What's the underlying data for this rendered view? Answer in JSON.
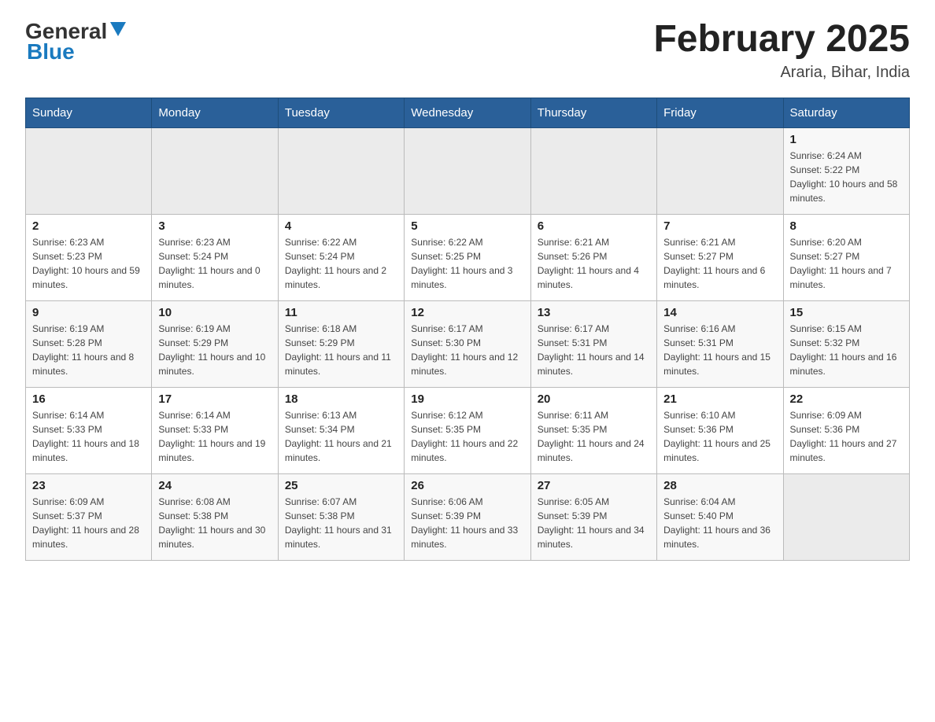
{
  "header": {
    "logo_general": "General",
    "logo_blue": "Blue",
    "title": "February 2025",
    "subtitle": "Araria, Bihar, India"
  },
  "weekdays": [
    "Sunday",
    "Monday",
    "Tuesday",
    "Wednesday",
    "Thursday",
    "Friday",
    "Saturday"
  ],
  "weeks": [
    [
      {
        "day": "",
        "sunrise": "",
        "sunset": "",
        "daylight": ""
      },
      {
        "day": "",
        "sunrise": "",
        "sunset": "",
        "daylight": ""
      },
      {
        "day": "",
        "sunrise": "",
        "sunset": "",
        "daylight": ""
      },
      {
        "day": "",
        "sunrise": "",
        "sunset": "",
        "daylight": ""
      },
      {
        "day": "",
        "sunrise": "",
        "sunset": "",
        "daylight": ""
      },
      {
        "day": "",
        "sunrise": "",
        "sunset": "",
        "daylight": ""
      },
      {
        "day": "1",
        "sunrise": "Sunrise: 6:24 AM",
        "sunset": "Sunset: 5:22 PM",
        "daylight": "Daylight: 10 hours and 58 minutes."
      }
    ],
    [
      {
        "day": "2",
        "sunrise": "Sunrise: 6:23 AM",
        "sunset": "Sunset: 5:23 PM",
        "daylight": "Daylight: 10 hours and 59 minutes."
      },
      {
        "day": "3",
        "sunrise": "Sunrise: 6:23 AM",
        "sunset": "Sunset: 5:24 PM",
        "daylight": "Daylight: 11 hours and 0 minutes."
      },
      {
        "day": "4",
        "sunrise": "Sunrise: 6:22 AM",
        "sunset": "Sunset: 5:24 PM",
        "daylight": "Daylight: 11 hours and 2 minutes."
      },
      {
        "day": "5",
        "sunrise": "Sunrise: 6:22 AM",
        "sunset": "Sunset: 5:25 PM",
        "daylight": "Daylight: 11 hours and 3 minutes."
      },
      {
        "day": "6",
        "sunrise": "Sunrise: 6:21 AM",
        "sunset": "Sunset: 5:26 PM",
        "daylight": "Daylight: 11 hours and 4 minutes."
      },
      {
        "day": "7",
        "sunrise": "Sunrise: 6:21 AM",
        "sunset": "Sunset: 5:27 PM",
        "daylight": "Daylight: 11 hours and 6 minutes."
      },
      {
        "day": "8",
        "sunrise": "Sunrise: 6:20 AM",
        "sunset": "Sunset: 5:27 PM",
        "daylight": "Daylight: 11 hours and 7 minutes."
      }
    ],
    [
      {
        "day": "9",
        "sunrise": "Sunrise: 6:19 AM",
        "sunset": "Sunset: 5:28 PM",
        "daylight": "Daylight: 11 hours and 8 minutes."
      },
      {
        "day": "10",
        "sunrise": "Sunrise: 6:19 AM",
        "sunset": "Sunset: 5:29 PM",
        "daylight": "Daylight: 11 hours and 10 minutes."
      },
      {
        "day": "11",
        "sunrise": "Sunrise: 6:18 AM",
        "sunset": "Sunset: 5:29 PM",
        "daylight": "Daylight: 11 hours and 11 minutes."
      },
      {
        "day": "12",
        "sunrise": "Sunrise: 6:17 AM",
        "sunset": "Sunset: 5:30 PM",
        "daylight": "Daylight: 11 hours and 12 minutes."
      },
      {
        "day": "13",
        "sunrise": "Sunrise: 6:17 AM",
        "sunset": "Sunset: 5:31 PM",
        "daylight": "Daylight: 11 hours and 14 minutes."
      },
      {
        "day": "14",
        "sunrise": "Sunrise: 6:16 AM",
        "sunset": "Sunset: 5:31 PM",
        "daylight": "Daylight: 11 hours and 15 minutes."
      },
      {
        "day": "15",
        "sunrise": "Sunrise: 6:15 AM",
        "sunset": "Sunset: 5:32 PM",
        "daylight": "Daylight: 11 hours and 16 minutes."
      }
    ],
    [
      {
        "day": "16",
        "sunrise": "Sunrise: 6:14 AM",
        "sunset": "Sunset: 5:33 PM",
        "daylight": "Daylight: 11 hours and 18 minutes."
      },
      {
        "day": "17",
        "sunrise": "Sunrise: 6:14 AM",
        "sunset": "Sunset: 5:33 PM",
        "daylight": "Daylight: 11 hours and 19 minutes."
      },
      {
        "day": "18",
        "sunrise": "Sunrise: 6:13 AM",
        "sunset": "Sunset: 5:34 PM",
        "daylight": "Daylight: 11 hours and 21 minutes."
      },
      {
        "day": "19",
        "sunrise": "Sunrise: 6:12 AM",
        "sunset": "Sunset: 5:35 PM",
        "daylight": "Daylight: 11 hours and 22 minutes."
      },
      {
        "day": "20",
        "sunrise": "Sunrise: 6:11 AM",
        "sunset": "Sunset: 5:35 PM",
        "daylight": "Daylight: 11 hours and 24 minutes."
      },
      {
        "day": "21",
        "sunrise": "Sunrise: 6:10 AM",
        "sunset": "Sunset: 5:36 PM",
        "daylight": "Daylight: 11 hours and 25 minutes."
      },
      {
        "day": "22",
        "sunrise": "Sunrise: 6:09 AM",
        "sunset": "Sunset: 5:36 PM",
        "daylight": "Daylight: 11 hours and 27 minutes."
      }
    ],
    [
      {
        "day": "23",
        "sunrise": "Sunrise: 6:09 AM",
        "sunset": "Sunset: 5:37 PM",
        "daylight": "Daylight: 11 hours and 28 minutes."
      },
      {
        "day": "24",
        "sunrise": "Sunrise: 6:08 AM",
        "sunset": "Sunset: 5:38 PM",
        "daylight": "Daylight: 11 hours and 30 minutes."
      },
      {
        "day": "25",
        "sunrise": "Sunrise: 6:07 AM",
        "sunset": "Sunset: 5:38 PM",
        "daylight": "Daylight: 11 hours and 31 minutes."
      },
      {
        "day": "26",
        "sunrise": "Sunrise: 6:06 AM",
        "sunset": "Sunset: 5:39 PM",
        "daylight": "Daylight: 11 hours and 33 minutes."
      },
      {
        "day": "27",
        "sunrise": "Sunrise: 6:05 AM",
        "sunset": "Sunset: 5:39 PM",
        "daylight": "Daylight: 11 hours and 34 minutes."
      },
      {
        "day": "28",
        "sunrise": "Sunrise: 6:04 AM",
        "sunset": "Sunset: 5:40 PM",
        "daylight": "Daylight: 11 hours and 36 minutes."
      },
      {
        "day": "",
        "sunrise": "",
        "sunset": "",
        "daylight": ""
      }
    ]
  ]
}
